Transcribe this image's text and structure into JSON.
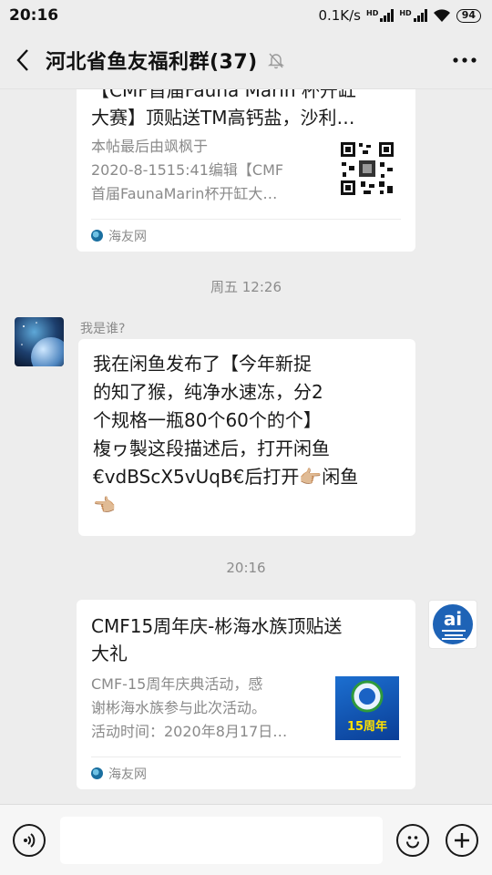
{
  "status_bar": {
    "time": "20:16",
    "speed": "0.1K/s",
    "battery": "94",
    "signal_label": "HD"
  },
  "header": {
    "title": "河北省鱼友福利群(37)"
  },
  "messages": {
    "card1": {
      "title_line1": "【CMF首届Fauna Marin 杯开缸",
      "title_line2": "大赛】顶贴送TM高钙盐，沙利…",
      "desc_line1": "本帖最后由飒枫于",
      "desc_line2": "2020-8-1515:41编辑【CMF",
      "desc_line3": "首届FaunaMarin杯开缸大…",
      "source": "海友网"
    },
    "timestamp1": "周五 12:26",
    "msg2": {
      "sender": "我是谁?",
      "line1": "我在闲鱼发布了【今年新捉",
      "line2": "的知了猴，纯净水速冻，分2",
      "line3": "个规格一瓶80个60个的个】",
      "line4": "椱ヮ製这段描述后，打开闲鱼",
      "line5": "€vdBScX5vUqB€后打开👉🏼闲鱼",
      "line6": "👈🏼"
    },
    "timestamp2": "20:16",
    "card3": {
      "title_line1": "CMF15周年庆-彬海水族顶贴送",
      "title_line2": "大礼",
      "desc_line1": "CMF-15周年庆典活动，感",
      "desc_line2": "谢彬海水族参与此次活动。",
      "desc_line3": "活动时间：2020年8月17日…",
      "source": "海友网",
      "thumb_text": "15周年",
      "avatar_text": "ai"
    }
  }
}
